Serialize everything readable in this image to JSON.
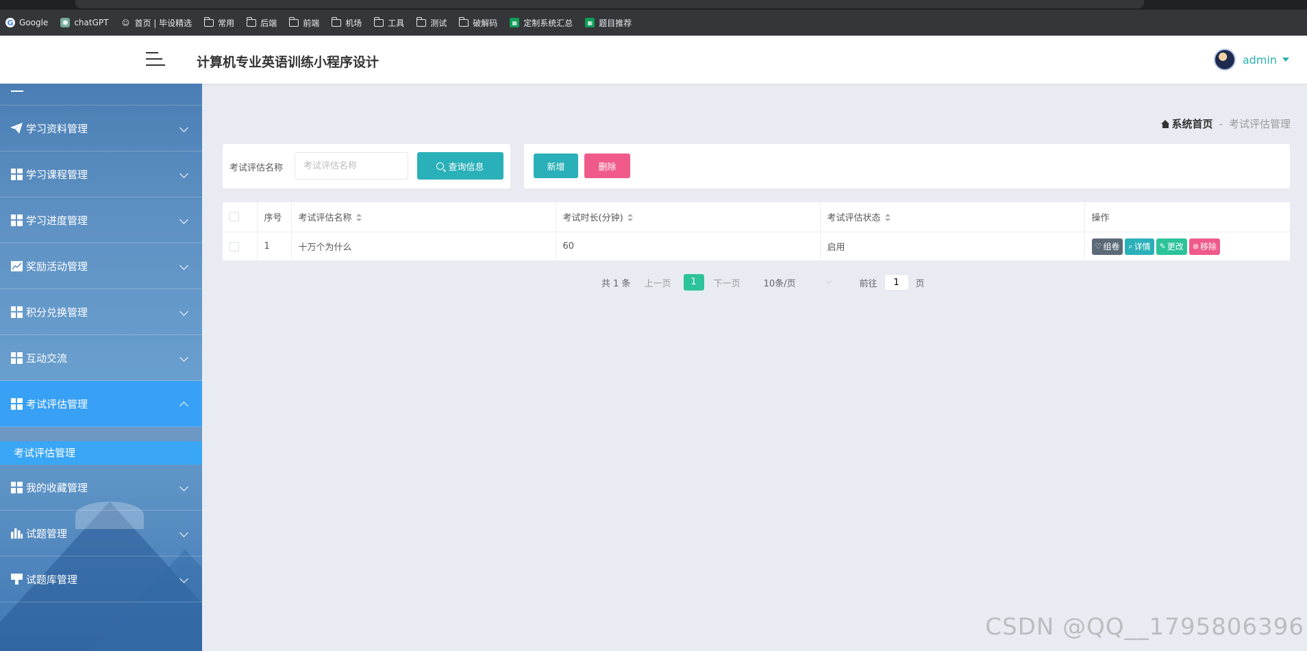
{
  "bookmarks": [
    {
      "label": "Google",
      "icon": "google-icon"
    },
    {
      "label": "chatGPT",
      "icon": "chatgpt-icon"
    },
    {
      "label": "首页 | 毕设精选",
      "icon": "site-icon"
    },
    {
      "label": "常用",
      "icon": "folder-icon"
    },
    {
      "label": "后端",
      "icon": "folder-icon"
    },
    {
      "label": "前端",
      "icon": "folder-icon"
    },
    {
      "label": "机场",
      "icon": "folder-icon"
    },
    {
      "label": "工具",
      "icon": "folder-icon"
    },
    {
      "label": "测试",
      "icon": "folder-icon"
    },
    {
      "label": "破解码",
      "icon": "folder-icon"
    },
    {
      "label": "定制系统汇总",
      "icon": "sheet-icon"
    },
    {
      "label": "题目推荐",
      "icon": "sheet-icon"
    }
  ],
  "header": {
    "title": "计算机专业英语训练小程序设计",
    "username": "admin"
  },
  "sidebar": {
    "items": [
      {
        "label": "学习资料管理",
        "icon": "paper-plane-icon"
      },
      {
        "label": "学习课程管理",
        "icon": "grid-icon"
      },
      {
        "label": "学习进度管理",
        "icon": "grid-icon"
      },
      {
        "label": "奖励活动管理",
        "icon": "line-chart-icon"
      },
      {
        "label": "积分兑换管理",
        "icon": "grid-icon"
      },
      {
        "label": "互动交流",
        "icon": "grid-icon"
      },
      {
        "label": "考试评估管理",
        "icon": "grid-icon"
      },
      {
        "label": "我的收藏管理",
        "icon": "grid-icon"
      },
      {
        "label": "试题管理",
        "icon": "bar-chart-icon"
      },
      {
        "label": "试题库管理",
        "icon": "stamp-icon"
      }
    ],
    "submenu": {
      "label": "考试评估管理"
    }
  },
  "breadcrumb": {
    "home": "系统首页",
    "separator": "-",
    "current": "考试评估管理"
  },
  "search": {
    "label": "考试评估名称",
    "placeholder": "考试评估名称",
    "button": "查询信息"
  },
  "actions": {
    "add": "新增",
    "delete": "删除"
  },
  "table": {
    "columns": [
      "序号",
      "考试评估名称",
      "考试时长(分钟)",
      "考试评估状态",
      "操作"
    ],
    "rows": [
      {
        "index": "1",
        "name": "十万个为什么",
        "duration": "60",
        "status": "启用"
      }
    ],
    "row_buttons": {
      "zujuan": "组卷",
      "detail": "详情",
      "edit": "更改",
      "remove": "移除"
    }
  },
  "pagination": {
    "total": "共 1 条",
    "prev": "上一页",
    "current": "1",
    "next": "下一页",
    "page_size": "10条/页",
    "goto_prefix": "前往",
    "goto_value": "1",
    "goto_suffix": "页"
  },
  "watermark": "CSDN @QQ__1795806396",
  "colors": {
    "accent_teal": "#2ab0b8",
    "accent_green": "#2cc39a",
    "accent_pink": "#f05a8a",
    "sidebar_active": "#38a0f5"
  }
}
